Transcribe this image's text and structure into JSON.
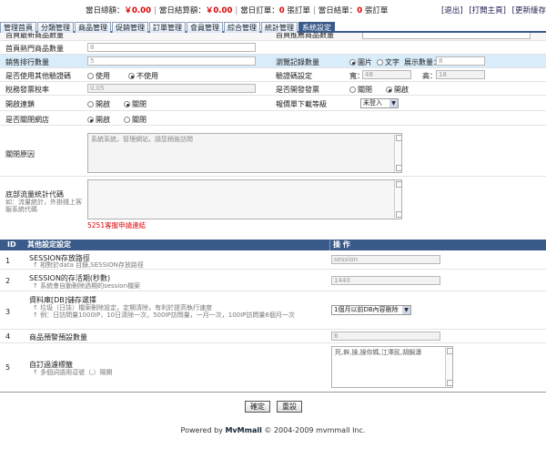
{
  "topbar": {
    "today_total_label": "當日總額：",
    "today_total_value": "￥0.00",
    "today_settled_label": "當日結算額：",
    "today_settled_value": "￥0.00",
    "today_orders_label": "當日訂單：",
    "today_orders_value": "0",
    "today_orders_unit": "張訂單",
    "today_closed_label": "當日結單：",
    "today_closed_value": "0",
    "today_closed_unit": "張訂單",
    "logout": "[退出]",
    "open_home": "[打開主頁]",
    "update_cache": "[更新緩存"
  },
  "nav": {
    "tabs": [
      "管理首頁",
      "分類管理",
      "商品管理",
      "促銷管理",
      "訂單管理",
      "會員管理",
      "綜合管理",
      "統計管理",
      "系統設定"
    ]
  },
  "settings": {
    "row0_label": "首頁最新商品數量",
    "row0_right_label": "首頁推薦商品數量",
    "row1_label": "首頁熱門商品數量",
    "row1_value": "8",
    "row2_label": "銷售排行數量",
    "row2_value": "5",
    "row2_right_label": "瀏覽記錄數量",
    "row2_opt_image": "圖片",
    "row2_opt_text": "文字",
    "row2_show_count_label": "展示數量：",
    "row2_show_count_value": "8",
    "row3_label": "是否使用其他驗證碼",
    "row3_opt_use": "使用",
    "row3_opt_nouse": "不使用",
    "row3_right_label": "驗證碼設定",
    "row3_width_label": "寬：",
    "row3_width_value": "48",
    "row3_height_label": "高：",
    "row3_height_value": "18",
    "row4_label": "稅務發票稅率",
    "row4_value": "0.05",
    "row4_right_label": "是否開發發票",
    "row4_opt_close": "關閉",
    "row4_opt_open": "開啟",
    "row5_label": "開啟連鎖",
    "row5_opt_open": "開啟",
    "row5_opt_close": "關閉",
    "row5_right_label": "報價單下載等級",
    "row5_select": "未登入",
    "row6_label": "是否關閉網店",
    "row6_opt_open": "開啟",
    "row6_opt_close": "關閉",
    "row7_label": "關閉原因",
    "row7_text": "系統系統，管理網站，請您稍後訪問",
    "row8_label": "底部流量統計代碼",
    "row8_hint": "如：流量統計，外掛錢上客服系統代碼",
    "row8_link": "5251客服申請連結"
  },
  "table": {
    "col_id": "ID",
    "col_setting": "其他設定設定",
    "col_action": "操 作",
    "rows": [
      {
        "id": "1",
        "title": "SESSION存放路徑",
        "hint": "↑ 相對於data 目錄,SESSION存放路徑",
        "value": "session"
      },
      {
        "id": "2",
        "title": "SESSION的存活期(秒數)",
        "hint": "↑ 系統會自動刪除過期的session檔案",
        "value": "1440"
      },
      {
        "id": "3",
        "title": "資料庫[DB]儲存選擇",
        "hint": "↑ 垃圾（日誌）檔案刪除設定，定期清除，有利於提高執行速度",
        "hint2": "↑ 例：日訪問量1000IP，10日清除一次，500IP訪問量，一月一次，100IP訪問量6個月一次",
        "value": "1個月以前DB內容刪除"
      },
      {
        "id": "4",
        "title": "商品預警預設數量",
        "hint": "",
        "value": "6"
      },
      {
        "id": "5",
        "title": "自訂過濾標籤",
        "hint": "↑ 多個詞語用逗號（,）隔開",
        "value": "死,幹,操,操你媽,江澤民,胡錦濤"
      }
    ]
  },
  "buttons": {
    "confirm": "確定",
    "reset": "重設"
  },
  "footer": {
    "prefix": "Powered by",
    "brand": "MvMmall",
    "copyright": "© 2004-2009 mvmmall Inc."
  }
}
